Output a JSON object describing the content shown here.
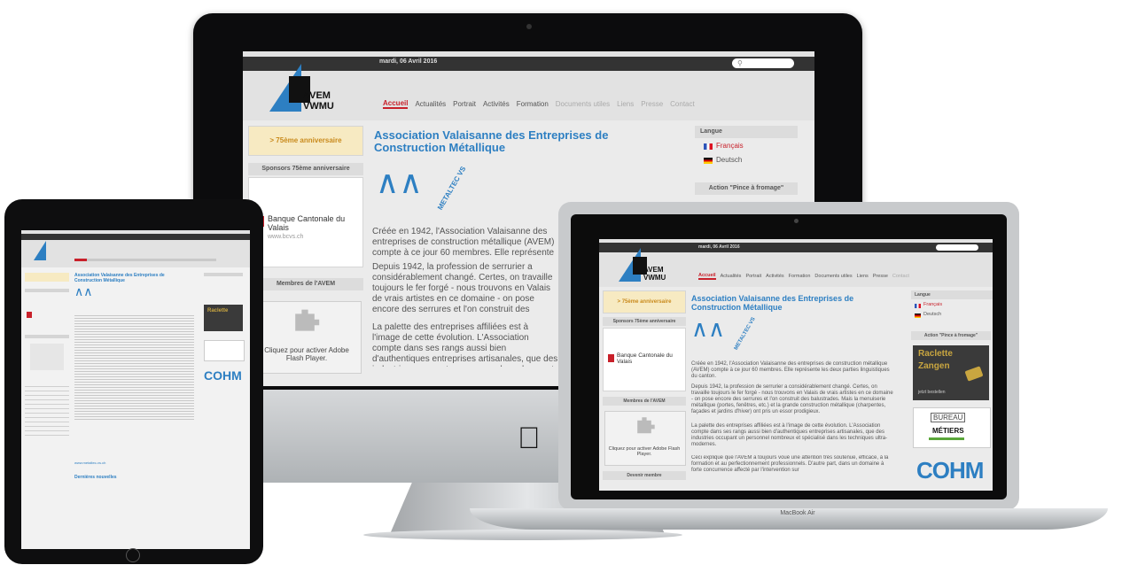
{
  "site": {
    "date": "mardi, 06 Avril 2016",
    "logo_line1": "AVEM",
    "logo_line2": "VWMU",
    "nav": [
      "Accueil",
      "Actualités",
      "Portrait",
      "Activités",
      "Formation",
      "Documents utiles",
      "Liens",
      "Presse",
      "Contact"
    ],
    "anniversary": "> 75ème anniversaire",
    "sponsors_title": "Sponsors 75ème anniversaire",
    "bank_name": "Banque Cantonale du Valais",
    "bank_url": "www.bcvs.ch",
    "members_title": "Membres de l'AVEM",
    "flash_text": "Cliquez pour activer Adobe Flash Player.",
    "become_member": "Devenir membre",
    "title": "Association Valaisanne des Entreprises de Construction Métallique",
    "metaltec": "METALTEC VS",
    "para1": "Créée en 1942, l'Association Valaisanne des entreprises de construction métallique (AVEM) compte à ce jour 60 membres. Elle représente les deux parties linguistiques du canton.",
    "para2": "Depuis 1942, la profession de serrurier a considérablement changé. Certes, on travaille toujours le fer forgé - nous trouvons en Valais de vrais artistes en ce domaine - on pose encore des serrures et l'on construit des balustrades. Mais la menuiserie métallique (portes, fenêtres, etc.) et la grande construction métallique (charpentes, façades et jardins d'hiver) ont pris un essor prodigieux.",
    "para3": "La palette des entreprises affiliées est à l'image de cette évolution. L'Association compte dans ses rangs aussi bien d'authentiques entreprises artisanales, que des industries occupant un personnel nombreux et spécialisé dans les techniques ultra-modernes.",
    "para4": "Ceci explique que l'AVEM a toujours voué une attention très soutenue, efficace, à la formation et au perfectionnement professionnels. D'autre part, dans un domaine à forte concurrence affecté par l'intervention sur",
    "langue_title": "Langue",
    "lang_fr": "Français",
    "lang_de": "Deutsch",
    "action_title": "Action \"Pince à fromage\"",
    "raclette": "Raclette",
    "zangen": "Zangen",
    "jetzt": "jetzt bestellen",
    "bureau": "BUREAU",
    "metiers": "MÉTIERS",
    "cohm": "COHM",
    "ipad_news": "Dernières nouvelles",
    "ipad_url": "www.metaltec-vs.ch"
  },
  "devices": {
    "macbook_label": "MacBook Air"
  },
  "colors": {
    "accent_blue": "#2d7fc2",
    "nav_red": "#c8202a",
    "raclette_gold": "#c9a640"
  }
}
